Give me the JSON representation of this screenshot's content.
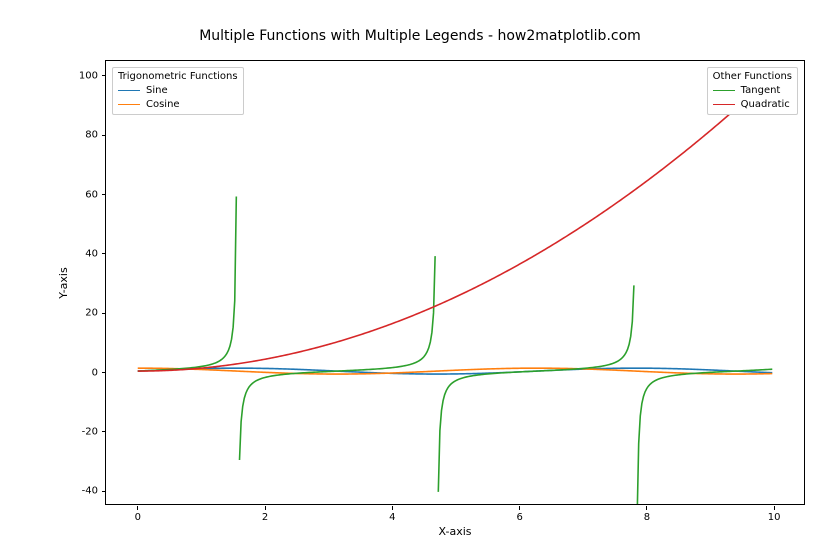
{
  "chart_data": {
    "type": "line",
    "title": "Multiple Functions with Multiple Legends - how2matplotlib.com",
    "xlabel": "X-axis",
    "ylabel": "Y-axis",
    "xlim": [
      -0.5,
      10.5
    ],
    "ylim": [
      -45,
      105
    ],
    "xticks": [
      0,
      2,
      4,
      6,
      8,
      10
    ],
    "yticks": [
      -40,
      -20,
      0,
      20,
      40,
      60,
      80,
      100
    ],
    "x": [
      0,
      0.5,
      1,
      1.5,
      2,
      2.5,
      3,
      3.5,
      4,
      4.5,
      5,
      5.5,
      6,
      6.5,
      7,
      7.5,
      8,
      8.5,
      9,
      9.5,
      10
    ],
    "series": [
      {
        "name": "Sine",
        "expr": "sin(x)",
        "color": "#1f77b4"
      },
      {
        "name": "Cosine",
        "expr": "cos(x)",
        "color": "#ff7f0e"
      },
      {
        "name": "Tangent",
        "expr": "tan(x)",
        "color": "#2ca02c"
      },
      {
        "name": "Quadratic",
        "expr": "x**2",
        "color": "#d62728"
      }
    ],
    "legends": [
      {
        "title": "Trigonometric Functions",
        "position": "upper-left",
        "items": [
          {
            "label": "Sine",
            "color": "#1f77b4"
          },
          {
            "label": "Cosine",
            "color": "#ff7f0e"
          }
        ]
      },
      {
        "title": "Other Functions",
        "position": "upper-right",
        "items": [
          {
            "label": "Tangent",
            "color": "#2ca02c"
          },
          {
            "label": "Quadratic",
            "color": "#d62728"
          }
        ]
      }
    ]
  }
}
